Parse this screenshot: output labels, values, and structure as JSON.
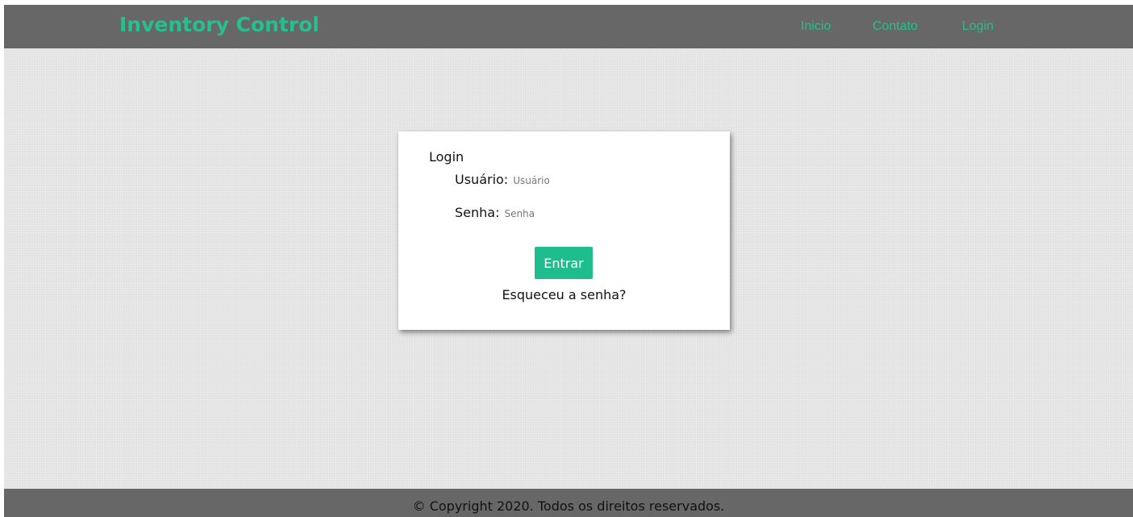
{
  "header": {
    "brand": "Inventory Control",
    "nav": [
      {
        "label": "Inicio"
      },
      {
        "label": "Contato"
      },
      {
        "label": "Login"
      }
    ]
  },
  "login_card": {
    "title": "Login",
    "username_label": "Usuário:",
    "username_placeholder": "Usuário",
    "username_value": "",
    "password_label": "Senha:",
    "password_placeholder": "Senha",
    "password_value": "",
    "submit_label": "Entrar",
    "forgot_link": "Esqueceu a senha?"
  },
  "footer": {
    "text": "© Copyright 2020. Todos os direitos reservados."
  },
  "colors": {
    "accent": "#27bf8f",
    "bar_background": "#676767",
    "page_background": "#e2e2e2",
    "card_background": "#ffffff"
  }
}
